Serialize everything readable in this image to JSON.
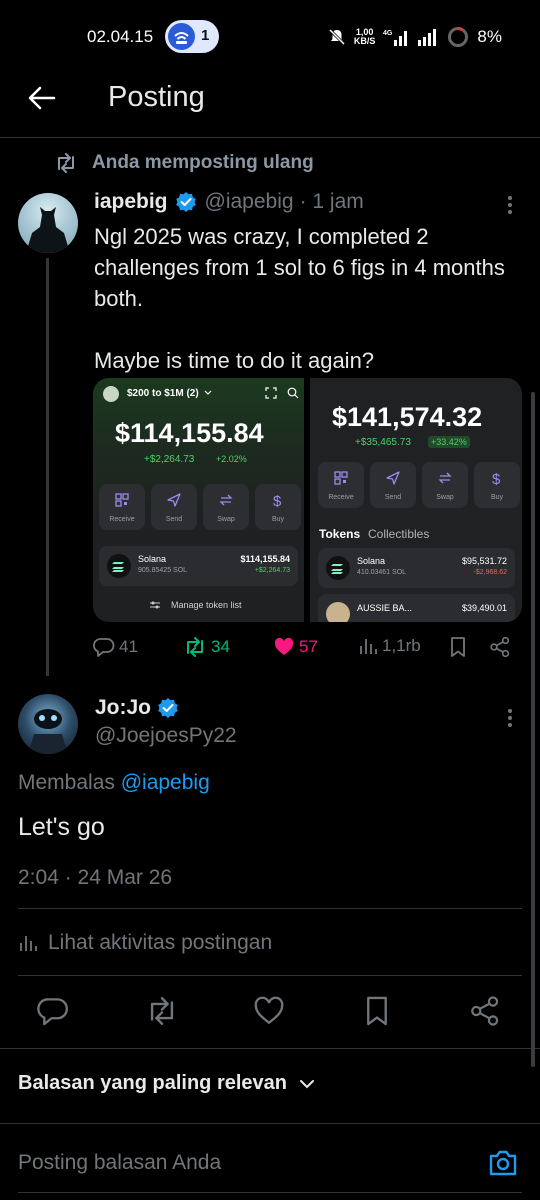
{
  "status_bar": {
    "time": "02.04.15",
    "notification_count": "1",
    "speed_value": "1,00",
    "speed_unit": "KB/S",
    "network": "4G",
    "battery": "8%"
  },
  "header": {
    "title": "Posting"
  },
  "repost_context": "Anda memposting ulang",
  "tweet": {
    "name": "iapebig",
    "handle": "@iapebig",
    "time": "· 1 jam",
    "text_line1": "Ngl 2025 was crazy, I completed 2 challenges from 1 sol to 6 figs in 4 months both.",
    "text_line2": "Maybe is time to do it again?",
    "media": {
      "left": {
        "wallet_label": "$200 to $1M (2)",
        "balance": "$114,155.84",
        "change": "+$2,264.73",
        "change_pct": "+2.02%",
        "actions": [
          "Receive",
          "Send",
          "Swap",
          "Buy"
        ],
        "token_name": "Solana",
        "token_amount": "905.85425 SOL",
        "token_value": "$114,155.84",
        "token_change": "+$2,264.73",
        "manage": "Manage token list"
      },
      "right": {
        "balance": "$141,574.32",
        "change": "+$35,465.73",
        "change_pct": "+33.42%",
        "actions": [
          "Receive",
          "Send",
          "Swap",
          "Buy"
        ],
        "tab_tokens": "Tokens",
        "tab_collectibles": "Collectibles",
        "token1_name": "Solana",
        "token1_amount": "410.03461 SOL",
        "token1_value": "$95,531.72",
        "token1_change": "-$2,968.62",
        "token2_name": "AUSSIE BA...",
        "token2_value": "$39,490.01"
      }
    },
    "stats": {
      "replies": "41",
      "reposts": "34",
      "likes": "57",
      "views": "1,1rb"
    }
  },
  "reply": {
    "name": "Jo:Jo",
    "handle": "@JoejoesPy22",
    "replying_label": "Membalas",
    "replying_to": "@iapebig",
    "text": "Let's go",
    "timestamp": "2:04 · 24 Mar 26",
    "activity_link": "Lihat aktivitas postingan"
  },
  "replies_sort": "Balasan yang paling relevan",
  "composer_placeholder": "Posting balasan Anda",
  "colors": {
    "background": "#000000",
    "accent_blue": "#1d9bf0",
    "repost_green": "#00ba7c",
    "like_pink": "#f91880",
    "muted": "#71767b"
  }
}
